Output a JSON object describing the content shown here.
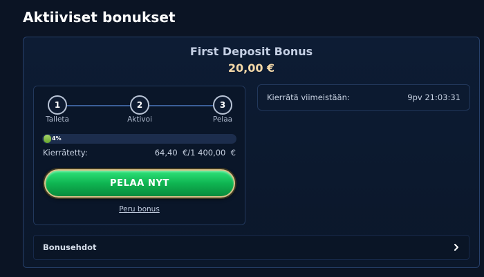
{
  "page": {
    "title": "Aktiiviset bonukset"
  },
  "bonus": {
    "name": "First Deposit Bonus",
    "amount": "20,00 €",
    "steps": [
      {
        "number": "1",
        "label": "Talleta"
      },
      {
        "number": "2",
        "label": "Aktivoi"
      },
      {
        "number": "3",
        "label": "Pelaa"
      }
    ],
    "progress": {
      "percent_label": "4%",
      "percent": 4
    },
    "wager": {
      "label": "Kierrätetty:",
      "value": "64,40  €/1 400,00  €"
    },
    "play_button": "PELAA NYT",
    "cancel_link": "Peru bonus",
    "expiry": {
      "label": "Kierrätä viimeistään:",
      "value": "9pv 21:03:31"
    },
    "terms": {
      "label": "Bonusehdot",
      "icon": "chevron-right-icon"
    }
  },
  "colors": {
    "background": "#0b1424",
    "accent_gold": "#f5d9a8",
    "button_green": "#0fb451",
    "progress_green": "#7dbb3f"
  }
}
